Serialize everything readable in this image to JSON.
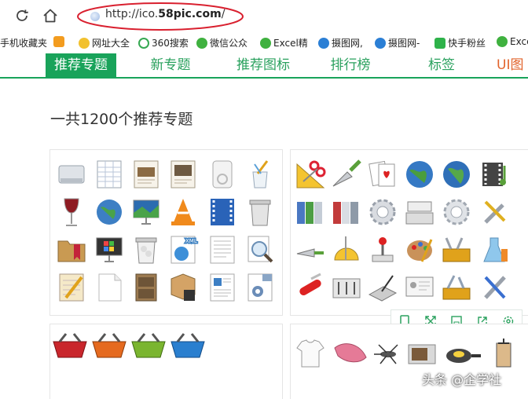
{
  "browser": {
    "url_prefix": "http://ico.",
    "url_domain": "58pic.com",
    "url_suffix": "/"
  },
  "bookmarks": [
    {
      "label": "手机收藏夹",
      "icon": "none",
      "color": "#ffffff"
    },
    {
      "label": "",
      "icon": "orange-square-icon",
      "color": "#f39c1f"
    },
    {
      "label": "网址大全",
      "icon": "yellow-shield-icon",
      "color": "#f2c12e"
    },
    {
      "label": "360搜索",
      "icon": "green-circle-icon",
      "color": "#36a852"
    },
    {
      "label": "微信公众",
      "icon": "wechat-icon",
      "color": "#3fb13f"
    },
    {
      "label": "Excel精",
      "icon": "wechat-icon",
      "color": "#3fb13f"
    },
    {
      "label": "摄图网,",
      "icon": "blue-bird-icon",
      "color": "#2b7fd5"
    },
    {
      "label": "摄图网-",
      "icon": "blue-bird-icon",
      "color": "#2b7fd5"
    },
    {
      "label": "快手粉丝",
      "icon": "green-square-icon",
      "color": "#2eb24a"
    },
    {
      "label": "Exce",
      "icon": "wechat-icon",
      "color": "#3fb13f"
    }
  ],
  "nav": {
    "tabs": [
      "推荐专题",
      "新专题",
      "推荐图标",
      "排行榜",
      "标签",
      "UI图"
    ]
  },
  "page": {
    "heading": "一共1200个推荐专题"
  },
  "toolbar": {
    "icons": [
      "phone-icon",
      "expand-icon",
      "save-icon",
      "share-icon",
      "settings-icon"
    ]
  },
  "watermark": "头条 @企学社",
  "colors": {
    "accent_green": "#19a35a",
    "accent_orange": "#e2632b",
    "annotation_red": "#d9202f"
  }
}
